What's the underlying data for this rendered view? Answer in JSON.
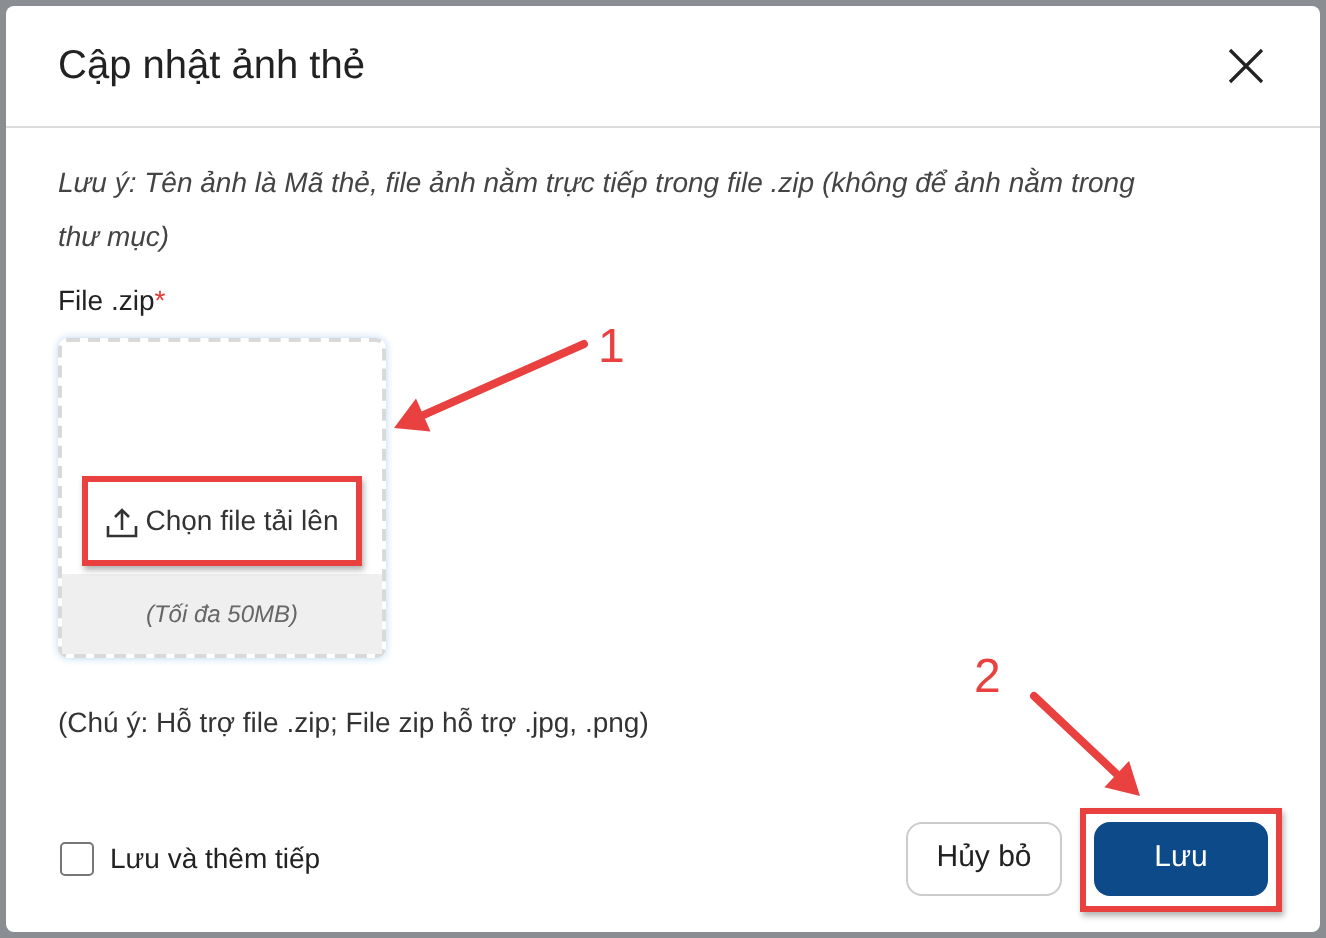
{
  "dialog": {
    "title": "Cập nhật ảnh thẻ"
  },
  "note": "Lưu ý: Tên ảnh là Mã thẻ, file ảnh nằm trực tiếp trong file .zip (không để ảnh nằm trong thư mục)",
  "field": {
    "label": "File .zip",
    "required_mark": "*"
  },
  "upload": {
    "button": "Chọn file tải lên",
    "hint": "(Tối đa 50MB)"
  },
  "support_note": "(Chú ý: Hỗ trợ file .zip; File zip hỗ trợ .jpg, .png)",
  "checkbox": {
    "label": "Lưu và thêm tiếp",
    "checked": false
  },
  "buttons": [
    {
      "label": "Hủy bỏ",
      "kind": "secondary"
    },
    {
      "label": "Lưu",
      "kind": "primary"
    }
  ],
  "annotations": [
    {
      "label": "1"
    },
    {
      "label": "2"
    }
  ]
}
